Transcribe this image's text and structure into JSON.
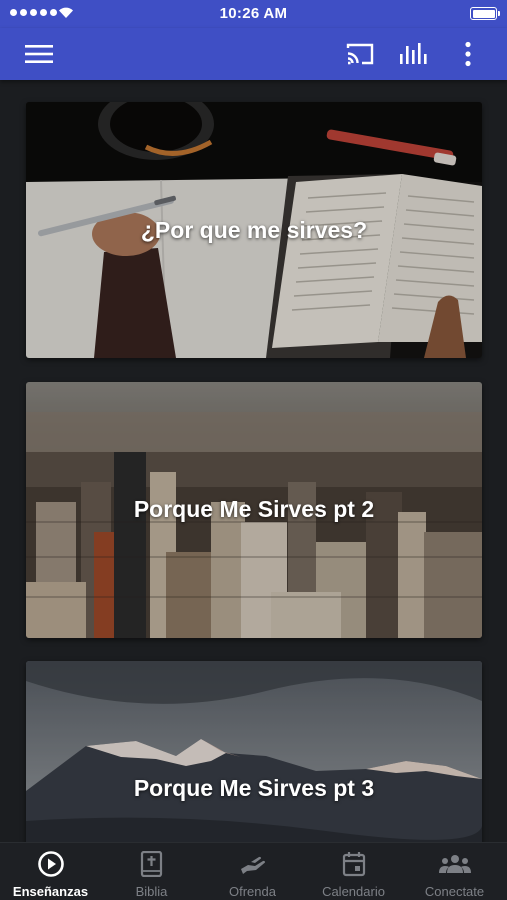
{
  "status_bar": {
    "time": "10:26 AM"
  },
  "header": {
    "icons": [
      "menu-icon",
      "cast-icon",
      "equalizer-icon",
      "more-vert-icon"
    ]
  },
  "colors": {
    "primary": "#3f4fc5",
    "background": "#1b1d20",
    "tab_bar": "#1e2024",
    "tab_active": "#ffffff",
    "tab_inactive": "#7d8086"
  },
  "feed": {
    "cards": [
      {
        "title": "¿Por que me sirves?"
      },
      {
        "title": "Porque Me Sirves pt 2"
      },
      {
        "title": "Porque Me Sirves pt 3"
      }
    ]
  },
  "tabs": [
    {
      "label": "Enseñanzas",
      "icon": "play-circle-icon",
      "active": true
    },
    {
      "label": "Biblia",
      "icon": "bible-icon",
      "active": false
    },
    {
      "label": "Ofrenda",
      "icon": "offering-hand-icon",
      "active": false
    },
    {
      "label": "Calendario",
      "icon": "calendar-icon",
      "active": false
    },
    {
      "label": "Conectate",
      "icon": "group-icon",
      "active": false
    }
  ]
}
